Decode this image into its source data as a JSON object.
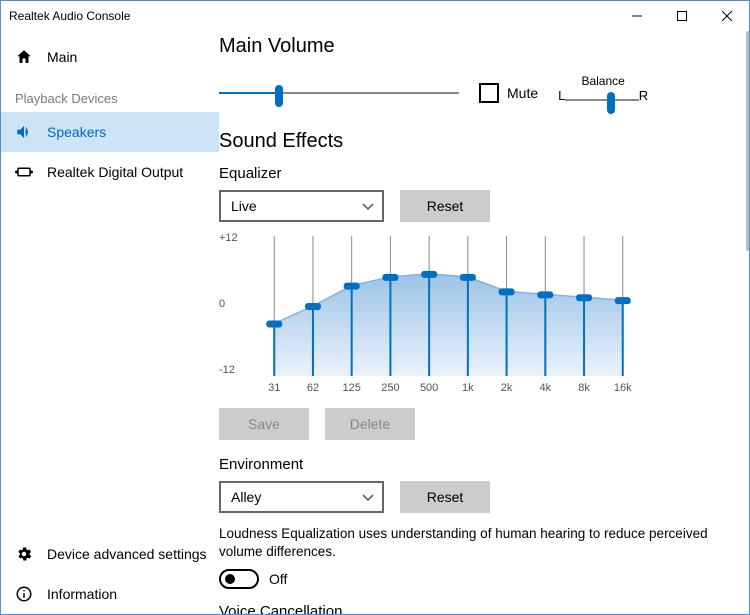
{
  "window": {
    "title": "Realtek Audio Console"
  },
  "sidebar": {
    "main": "Main",
    "playback_header": "Playback Devices",
    "speakers": "Speakers",
    "digital": "Realtek Digital Output",
    "advanced": "Device advanced settings",
    "info": "Information"
  },
  "main": {
    "volume_title": "Main Volume",
    "mute": "Mute",
    "balance_label": "Balance",
    "balance_l": "L",
    "balance_r": "R",
    "volume_pct": 25,
    "balance_pct": 62,
    "sound_effects": "Sound Effects",
    "equalizer": "Equalizer",
    "eq_preset": "Live",
    "reset": "Reset",
    "save": "Save",
    "delete": "Delete",
    "environment": "Environment",
    "env_preset": "Alley",
    "loudness_desc": "Loudness Equalization uses understanding of human hearing to reduce perceived volume differences.",
    "toggle_state": "Off",
    "voice_cancel": "Voice Cancellation"
  },
  "chart_data": {
    "type": "equalizer",
    "y_ticks": [
      "+12",
      "0",
      "-12"
    ],
    "ylim": [
      -12,
      12
    ],
    "bands": [
      "31",
      "62",
      "125",
      "250",
      "500",
      "1k",
      "2k",
      "4k",
      "8k",
      "16k"
    ],
    "values": [
      -3.0,
      0.0,
      3.5,
      5.0,
      5.5,
      5.0,
      2.5,
      2.0,
      1.5,
      1.0
    ]
  }
}
